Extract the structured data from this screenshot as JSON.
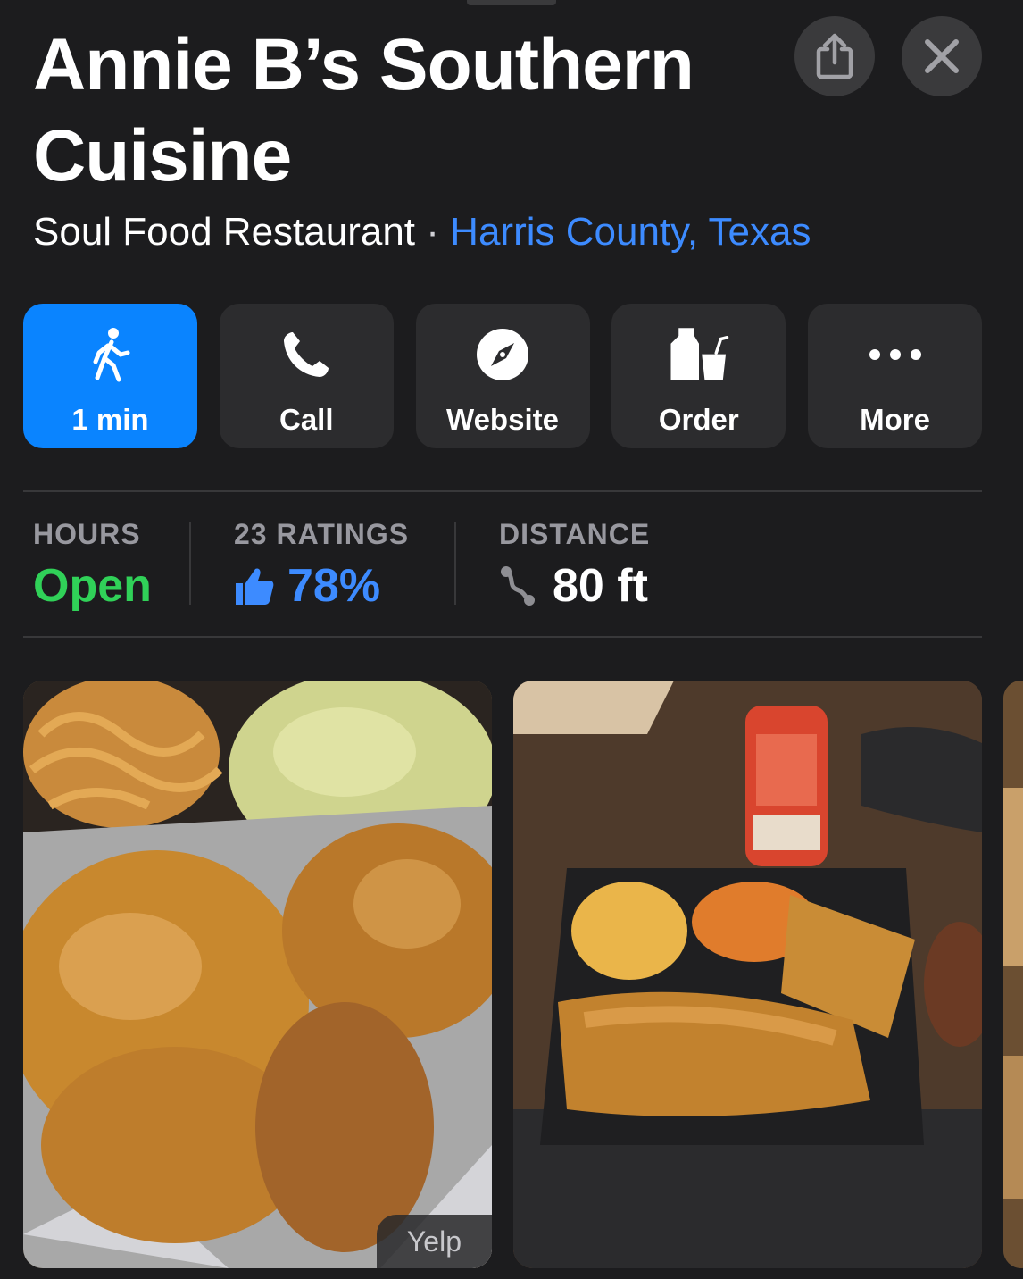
{
  "place": {
    "name": "Annie B’s Southern Cuisine",
    "category": "Soul Food Restaurant",
    "separator": "·",
    "location": "Harris County, Texas"
  },
  "header_buttons": {
    "share_icon": "share-icon",
    "close_icon": "close-icon"
  },
  "actions": [
    {
      "label": "1 min",
      "icon": "walking-icon",
      "primary": true
    },
    {
      "label": "Call",
      "icon": "phone-icon"
    },
    {
      "label": "Website",
      "icon": "compass-icon"
    },
    {
      "label": "Order",
      "icon": "order-bag-icon"
    },
    {
      "label": "More",
      "icon": "ellipsis-icon"
    }
  ],
  "stats": {
    "hours": {
      "heading": "HOURS",
      "value": "Open"
    },
    "ratings": {
      "heading": "23 RATINGS",
      "value": "78%",
      "icon": "thumbs-up-icon"
    },
    "distance": {
      "heading": "DISTANCE",
      "value": "80 ft",
      "icon": "route-icon"
    }
  },
  "photos": [
    {
      "description_icon": "fried-chicken-photo",
      "attribution": "Yelp"
    },
    {
      "description_icon": "catfish-plate-photo"
    },
    {
      "description_icon": "partial-photo"
    }
  ],
  "colors": {
    "background": "#1c1c1e",
    "button": "#2c2c2e",
    "accent_blue": "#0a84ff",
    "link_blue": "#3d8bff",
    "open_green": "#30d158",
    "secondary_text": "#98989f"
  }
}
